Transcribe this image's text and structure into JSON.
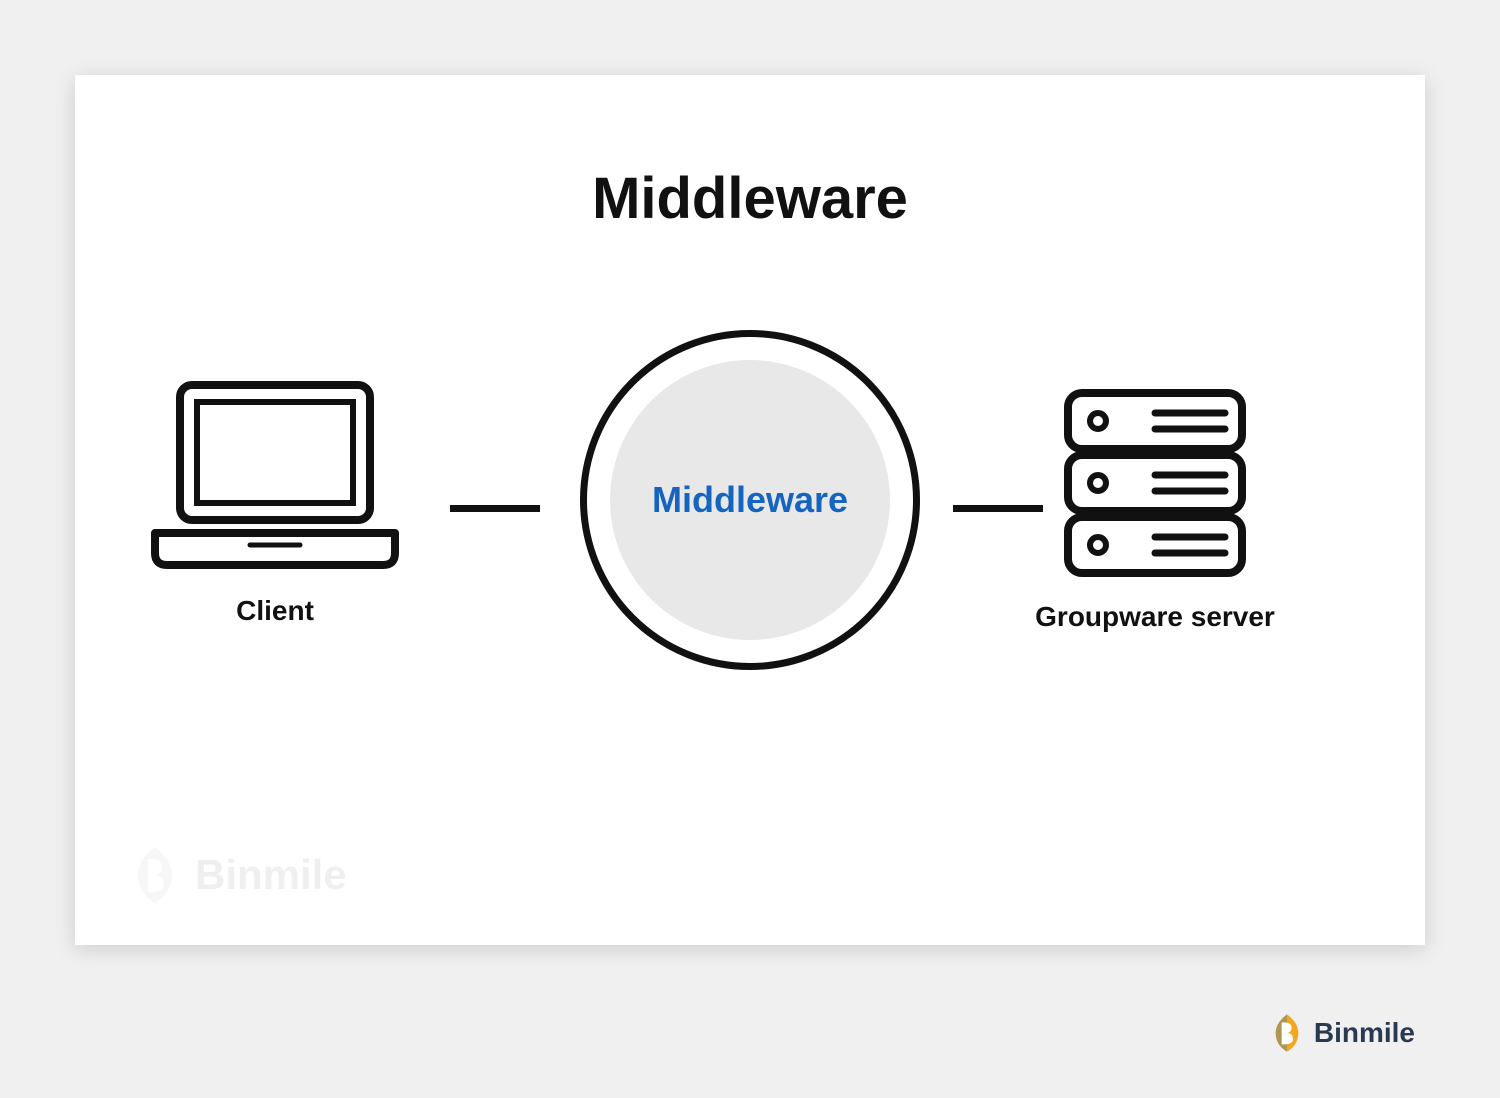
{
  "title": "Middleware",
  "middle_label": "Middleware",
  "client_label": "Client",
  "server_label": "Groupware server",
  "watermark": "Binmile",
  "brand": "Binmile",
  "colors": {
    "accent": "#1565c0",
    "stroke": "#111111",
    "card_bg": "#ffffff",
    "page_bg": "#f0f0f0",
    "brand_primary": "#f4a621",
    "brand_secondary": "#0b74bc"
  }
}
